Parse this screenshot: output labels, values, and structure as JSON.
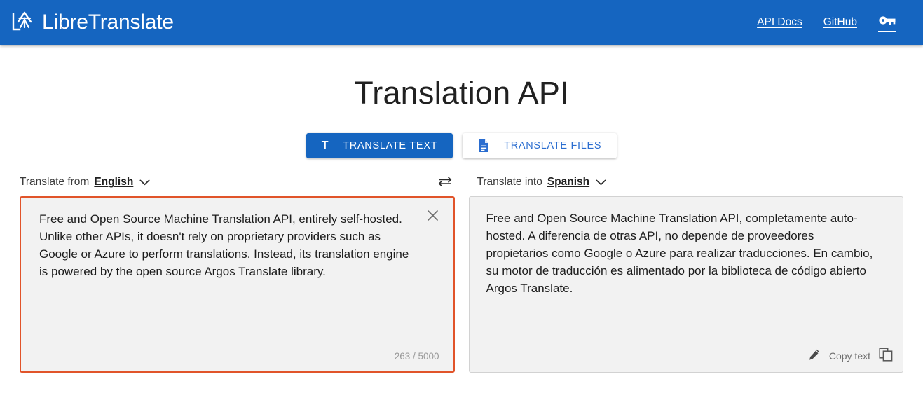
{
  "header": {
    "brand": "LibreTranslate",
    "logo_icon": "libretranslate-logo-icon",
    "links": [
      {
        "label": "API Docs",
        "name": "api-docs"
      },
      {
        "label": "GitHub",
        "name": "github"
      }
    ],
    "api_key_icon": "key-icon"
  },
  "main": {
    "title": "Translation API",
    "tabs": [
      {
        "label": "TRANSLATE TEXT",
        "icon": "text-t-icon",
        "active": true
      },
      {
        "label": "TRANSLATE FILES",
        "icon": "document-icon",
        "active": false
      }
    ]
  },
  "source": {
    "label": "Translate from",
    "language": "English",
    "dropdown_icon": "chevron-down-icon",
    "clear_icon": "close-x-icon",
    "text": "Free and Open Source Machine Translation API, entirely self-hosted. Unlike other APIs, it doesn't rely on proprietary providers such as Google or Azure to perform translations. Instead, its translation engine is powered by the open source Argos Translate library.",
    "char_count": "263 / 5000"
  },
  "swap": {
    "icon": "swap-horizontal-icon"
  },
  "target": {
    "label": "Translate into",
    "language": "Spanish",
    "dropdown_icon": "chevron-down-icon",
    "text": "Free and Open Source Machine Translation API, completamente auto-hosted. A diferencia de otras API, no depende de proveedores propietarios como Google o Azure para realizar traducciones. En cambio, su motor de traducción es alimentado por la biblioteca de código abierto Argos Translate.",
    "edit_icon": "pencil-edit-icon",
    "copy_label": "Copy text",
    "copy_icon": "copy-duplicate-icon"
  },
  "colors": {
    "brand_blue": "#1565c0",
    "source_border": "#e1542a",
    "panel_bg": "#f2f2f2",
    "tab_inactive_text": "#2a6dd0"
  }
}
